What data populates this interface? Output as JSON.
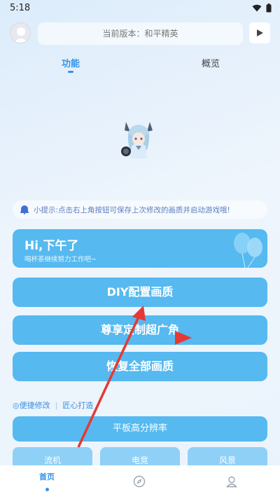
{
  "status": {
    "time": "5:18"
  },
  "header": {
    "version_text": "当前版本：和平精英"
  },
  "tabs": [
    {
      "label": "功能",
      "active": true
    },
    {
      "label": "概览",
      "active": false
    }
  ],
  "tip": {
    "text": "小提示:点击右上角按钮可保存上次修改的画质并启动游戏哦!"
  },
  "greeting": {
    "title": "Hi,下午了",
    "subtitle": "喝杯茶继续努力工作吧~"
  },
  "actions": {
    "diy": "DIY配置画质",
    "wide": "尊享定制超广角",
    "restore": "恢复全部画质"
  },
  "links": {
    "quick_edit": "◎便捷修改",
    "crafted": "匠心打造"
  },
  "tablet": {
    "label": "平板高分辨率"
  },
  "styles": [
    {
      "label": "流机"
    },
    {
      "label": "电竞"
    },
    {
      "label": "风景"
    }
  ],
  "nav": {
    "home": "首页"
  },
  "colors": {
    "accent": "#56b9f0",
    "tab_active": "#3592e8",
    "annotation": "#e53935"
  }
}
